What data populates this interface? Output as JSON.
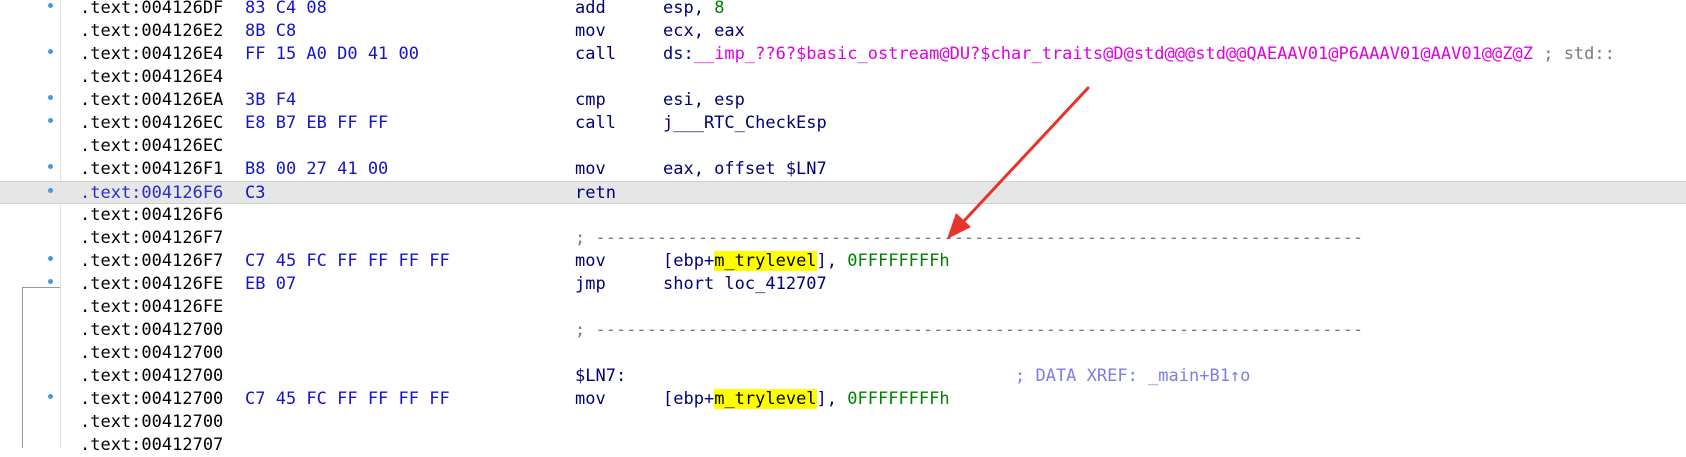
{
  "listing": {
    "highlight": "#ffff00",
    "rows": [
      {
        "bullet": true,
        "addr": ".text:004126DF",
        "bytes": "83 C4 08",
        "mnemonic": "add",
        "op_plain": "esp, ",
        "op_num": "8"
      },
      {
        "bullet": false,
        "addr": ".text:004126E2",
        "bytes": "8B C8",
        "mnemonic": "mov",
        "op_plain": "ecx, eax"
      },
      {
        "bullet": true,
        "addr": ".text:004126E4",
        "bytes": "FF 15 A0 D0 41 00",
        "mnemonic": "call",
        "op_plain": "ds:",
        "op_imp": "__imp_??6?$basic_ostream@DU?$char_traits@D@std@@@std@@QAEAAV01@P6AAAV01@AAV01@@Z@Z",
        "comment": " ; std::"
      },
      {
        "bullet": false,
        "addr": ".text:004126E4"
      },
      {
        "bullet": true,
        "addr": ".text:004126EA",
        "bytes": "3B F4",
        "mnemonic": "cmp",
        "op_plain": "esi, esp"
      },
      {
        "bullet": true,
        "addr": ".text:004126EC",
        "bytes": "E8 B7 EB FF FF",
        "mnemonic": "call",
        "op_plain": "j___RTC_CheckEsp"
      },
      {
        "bullet": false,
        "addr": ".text:004126EC"
      },
      {
        "bullet": true,
        "addr": ".text:004126F1",
        "bytes": "B8 00 27 41 00",
        "mnemonic": "mov",
        "op_plain": "eax, offset $LN7"
      },
      {
        "bullet": true,
        "addr": ".text:004126F6",
        "bytes": "C3",
        "mnemonic": "retn",
        "selected": true
      },
      {
        "bullet": false,
        "addr": ".text:004126F6"
      },
      {
        "bullet": false,
        "addr": ".text:004126F7",
        "separator": "; ---------------------------------------------------------------------------"
      },
      {
        "bullet": true,
        "addr": ".text:004126F7",
        "bytes": "C7 45 FC FF FF FF FF",
        "mnemonic": "mov",
        "op_pre": "[ebp+",
        "op_hl": "m_trylevel",
        "op_post": "], ",
        "op_num": "0FFFFFFFFh"
      },
      {
        "bullet": true,
        "addr": ".text:004126FE",
        "bytes": "EB 07",
        "mnemonic": "jmp",
        "op_plain": "short loc_412707"
      },
      {
        "bullet": false,
        "addr": ".text:004126FE"
      },
      {
        "bullet": false,
        "addr": ".text:00412700",
        "separator": "; ---------------------------------------------------------------------------"
      },
      {
        "bullet": false,
        "addr": ".text:00412700"
      },
      {
        "bullet": false,
        "addr": ".text:00412700",
        "label": "$LN7:",
        "xref": "; DATA XREF: _main+B1↑o"
      },
      {
        "bullet": true,
        "addr": ".text:00412700",
        "bytes": "C7 45 FC FF FF FF FF",
        "mnemonic": "mov",
        "op_pre": "[ebp+",
        "op_hl": "m_trylevel",
        "op_post": "], ",
        "op_num": "0FFFFFFFFh"
      },
      {
        "bullet": false,
        "addr": ".text:00412700"
      },
      {
        "bullet": false,
        "addr": ".text:00412707"
      }
    ]
  },
  "annotation": {
    "arrow_color": "#e8322a"
  }
}
